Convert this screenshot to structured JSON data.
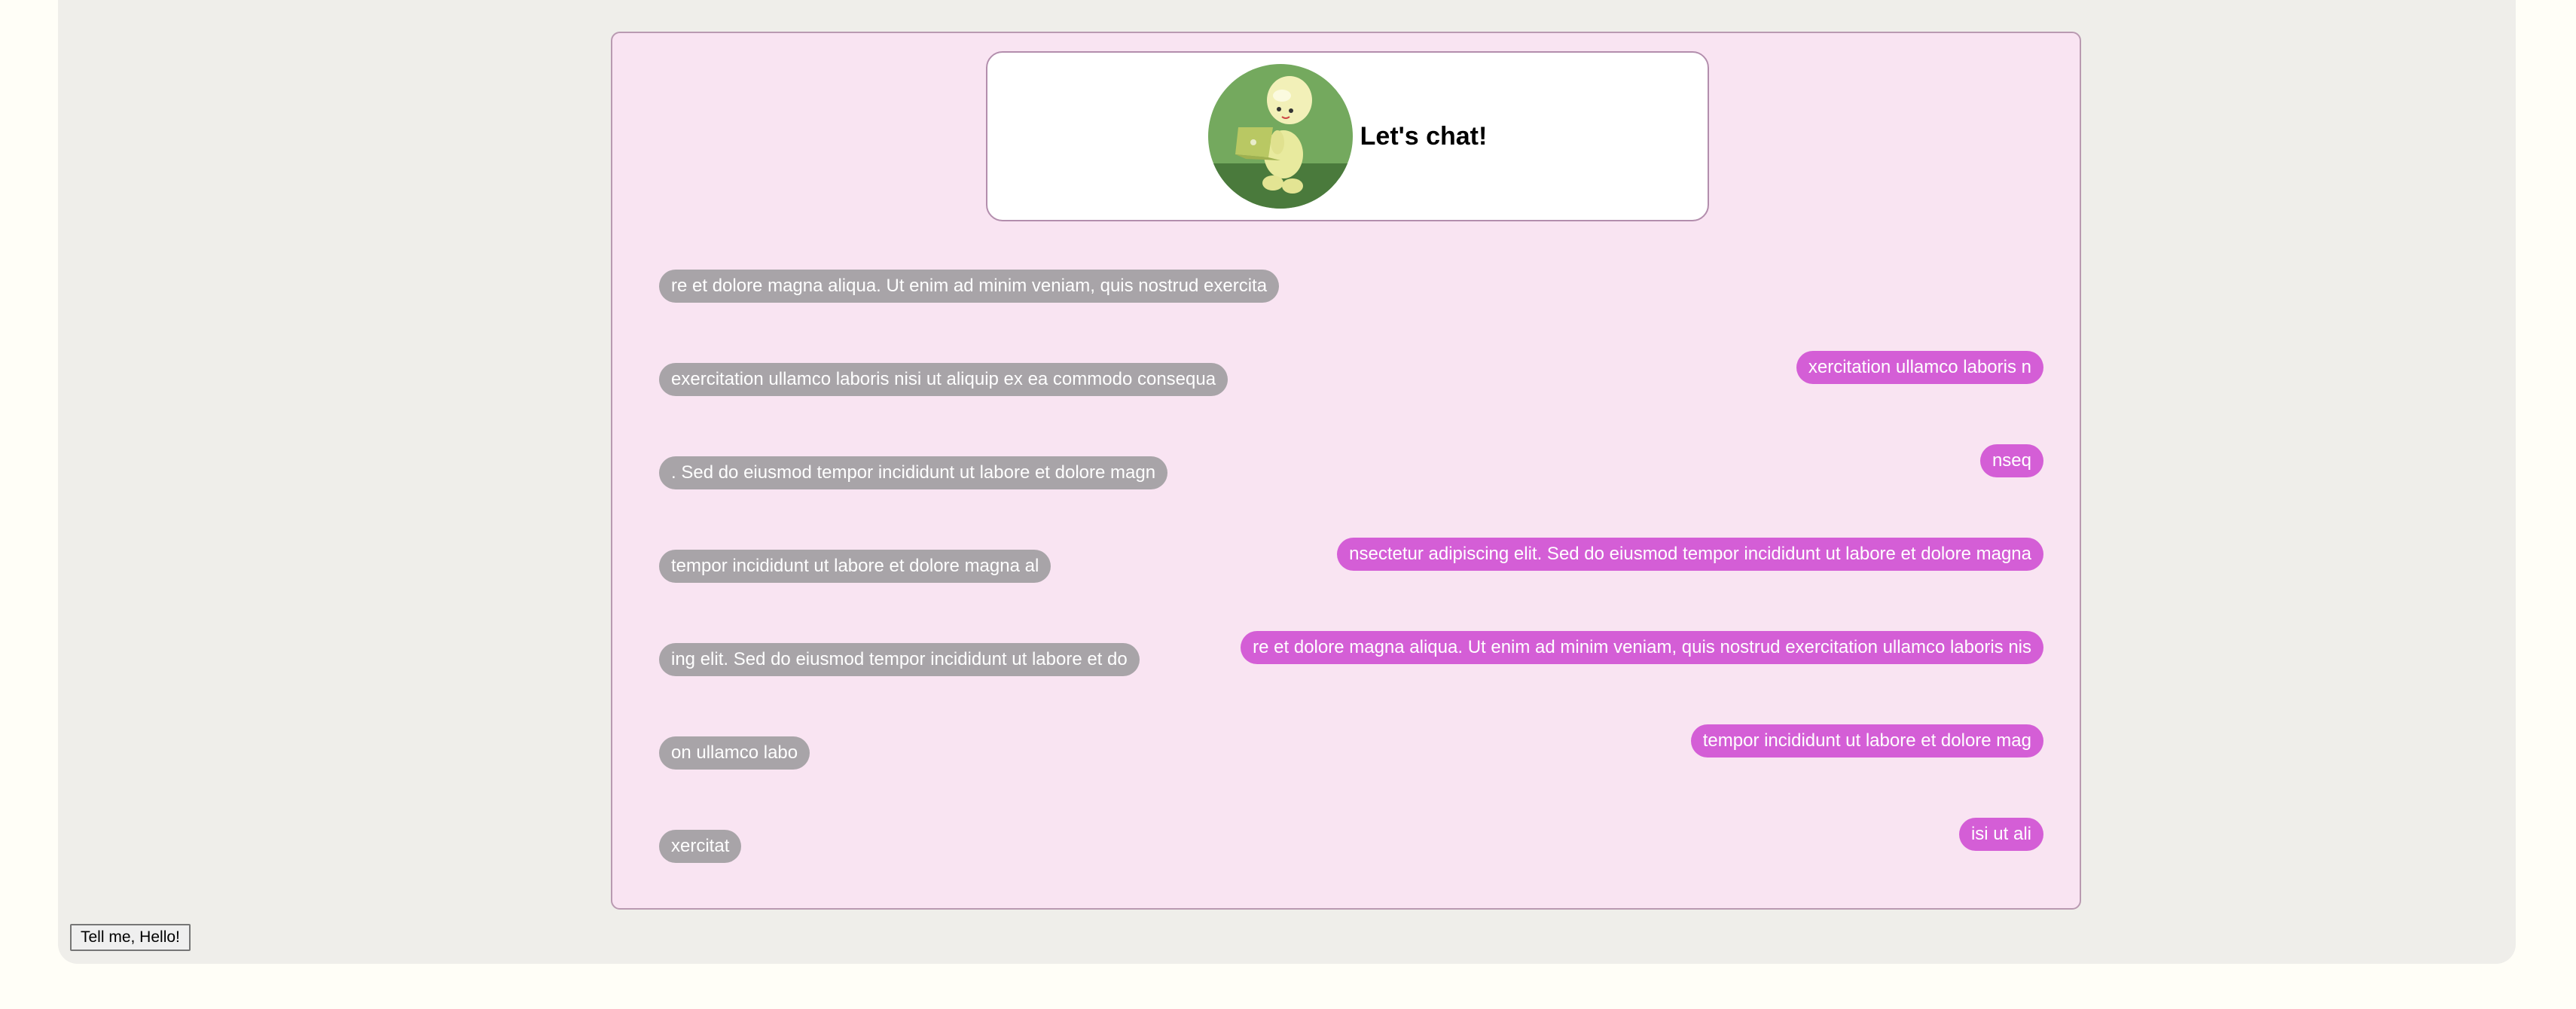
{
  "header": {
    "title": "Let's chat!",
    "avatar_icon": "person-with-laptop-avatar"
  },
  "messages_left": [
    "re et dolore magna aliqua. Ut enim ad minim veniam, quis nostrud exercita",
    "exercitation ullamco laboris nisi ut aliquip ex ea commodo consequa",
    ". Sed do eiusmod tempor incididunt ut labore et dolore magn",
    "tempor incididunt ut labore et dolore magna al",
    "ing elit. Sed do eiusmod tempor incididunt ut labore et do",
    "on ullamco labo",
    "xercitat"
  ],
  "messages_right": [
    "xercitation ullamco laboris n",
    "nseq",
    "nsectetur adipiscing elit. Sed do eiusmod tempor incididunt ut labore et dolore magna",
    "re et dolore magna aliqua. Ut enim ad minim veniam, quis nostrud exercitation ullamco laboris nis",
    "tempor incididunt ut labore et dolore mag",
    "isi ut ali"
  ],
  "button": {
    "label": "Tell me, Hello!"
  },
  "colors": {
    "page_bg": "#fffef7",
    "outer_bg": "#efeeea",
    "panel_bg": "#f9e4f2",
    "left_bubble": "#a8a4a8",
    "right_bubble": "#d45ed6"
  }
}
